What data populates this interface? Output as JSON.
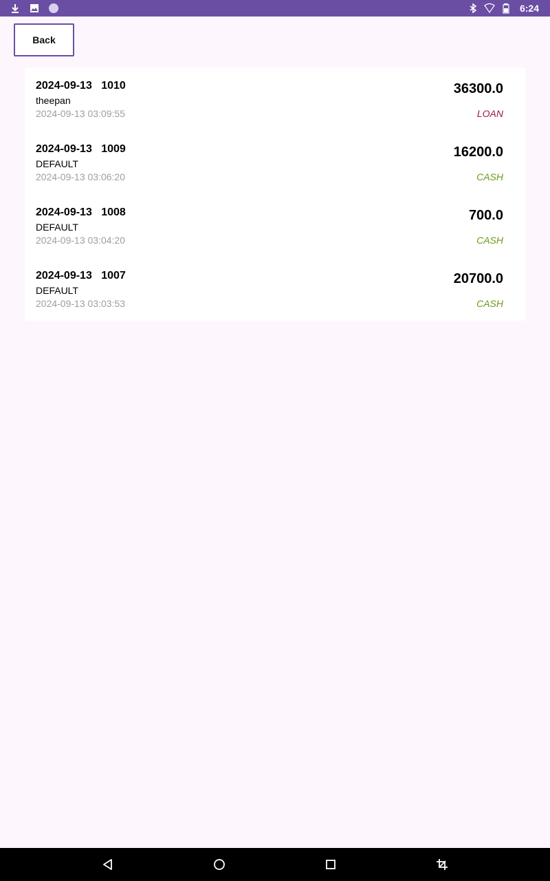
{
  "status_bar": {
    "time": "6:24",
    "icons": [
      "download-icon",
      "image-icon",
      "circle-app-icon",
      "bluetooth-icon",
      "wifi-icon",
      "battery-icon"
    ]
  },
  "back_button": {
    "label": "Back"
  },
  "transactions": [
    {
      "date": "2024-09-13",
      "number": "1010",
      "customer": "theepan",
      "timestamp": "2024-09-13 03:09:55",
      "amount": "36300.0",
      "type": "LOAN"
    },
    {
      "date": "2024-09-13",
      "number": "1009",
      "customer": "DEFAULT",
      "timestamp": "2024-09-13 03:06:20",
      "amount": "16200.0",
      "type": "CASH"
    },
    {
      "date": "2024-09-13",
      "number": "1008",
      "customer": "DEFAULT",
      "timestamp": "2024-09-13 03:04:20",
      "amount": "700.0",
      "type": "CASH"
    },
    {
      "date": "2024-09-13",
      "number": "1007",
      "customer": "DEFAULT",
      "timestamp": "2024-09-13 03:03:53",
      "amount": "20700.0",
      "type": "CASH"
    }
  ],
  "colors": {
    "status_bar": "#6a4ea3",
    "background": "#fdf6fd",
    "loan": "#a0183c",
    "cash": "#6a9a1a",
    "timestamp": "#9e9e9e"
  },
  "nav_bar": {
    "icons": [
      "back-triangle-icon",
      "home-circle-icon",
      "recents-square-icon",
      "screenshot-crop-icon"
    ]
  }
}
